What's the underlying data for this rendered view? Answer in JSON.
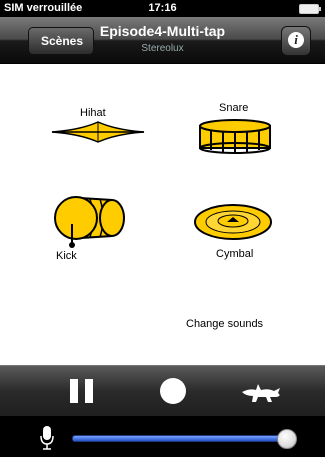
{
  "status_bar": {
    "carrier": "SIM verrouillée",
    "time": "17:16",
    "battery_icon": "battery-icon"
  },
  "nav": {
    "back_label": "Scènes",
    "title": "Episode4-Multi-tap",
    "subtitle": "Stereolux",
    "info_icon": "info-icon"
  },
  "instruments": {
    "hihat": {
      "label": "Hihat"
    },
    "snare": {
      "label": "Snare"
    },
    "kick": {
      "label": "Kick"
    },
    "cymbal": {
      "label": "Cymbal"
    }
  },
  "change_sounds_label": "Change sounds",
  "transport": {
    "pause_icon": "pause-icon",
    "record_icon": "record-icon",
    "animal_icon": "lizard-icon"
  },
  "volume": {
    "mic_icon": "microphone-icon",
    "level": 0.96
  },
  "colors": {
    "drum_yellow": "#ffcc00",
    "slider_blue": "#3a6fe0"
  }
}
